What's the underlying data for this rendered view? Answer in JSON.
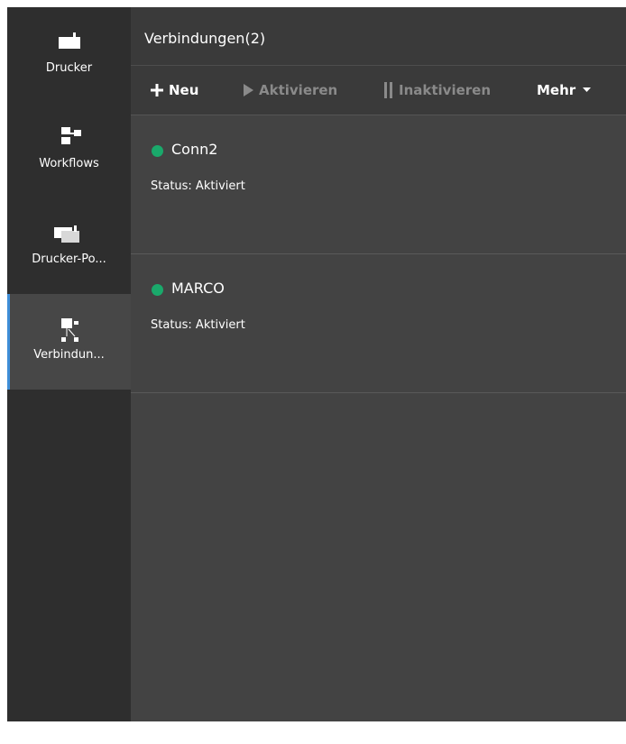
{
  "sidebar": {
    "items": [
      {
        "label": "Drucker",
        "icon": "printer-icon",
        "active": false
      },
      {
        "label": "Workflows",
        "icon": "workflow-icon",
        "active": false
      },
      {
        "label": "Drucker-Po...",
        "icon": "printer-pool-icon",
        "active": false
      },
      {
        "label": "Verbindun...",
        "icon": "connection-icon",
        "active": true
      }
    ]
  },
  "header": {
    "title": "Verbindungen(2)"
  },
  "toolbar": {
    "new_label": "Neu",
    "activate_label": "Aktivieren",
    "deactivate_label": "Inaktivieren",
    "more_label": "Mehr"
  },
  "connections": [
    {
      "name": "Conn2",
      "status": "Status: Aktiviert",
      "status_color": "#1aa96b"
    },
    {
      "name": "MARCO",
      "status": "Status: Aktiviert",
      "status_color": "#1aa96b"
    }
  ],
  "colors": {
    "accent": "#3f8ed8",
    "status_active": "#1aa96b",
    "background": "#434343",
    "sidebar": "#2e2e2e"
  }
}
